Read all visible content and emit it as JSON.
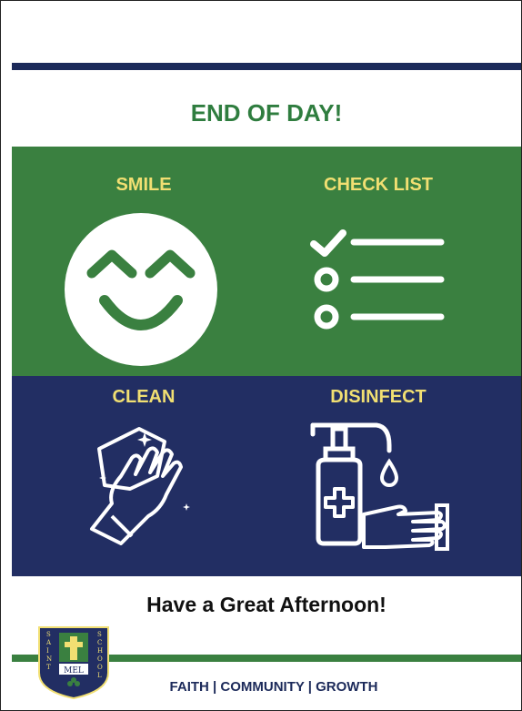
{
  "header": {
    "title": "END OF DAY!"
  },
  "tiles": [
    {
      "label": "SMILE",
      "icon": "smiley-face-icon"
    },
    {
      "label": "CHECK LIST",
      "icon": "checklist-icon"
    },
    {
      "label": "CLEAN",
      "icon": "glove-cleaning-icon"
    },
    {
      "label": "DISINFECT",
      "icon": "sanitizer-pump-icon"
    }
  ],
  "footer": {
    "message": "Have a Great Afternoon!",
    "tagline": "FAITH | COMMUNITY | GROWTH"
  },
  "crest": {
    "left_text": "SAINT",
    "right_text": "SCHOOL",
    "center_text": "MEL"
  },
  "colors": {
    "navy": "#222e63",
    "green": "#3a8040",
    "yellow": "#f1df72",
    "white": "#ffffff"
  }
}
